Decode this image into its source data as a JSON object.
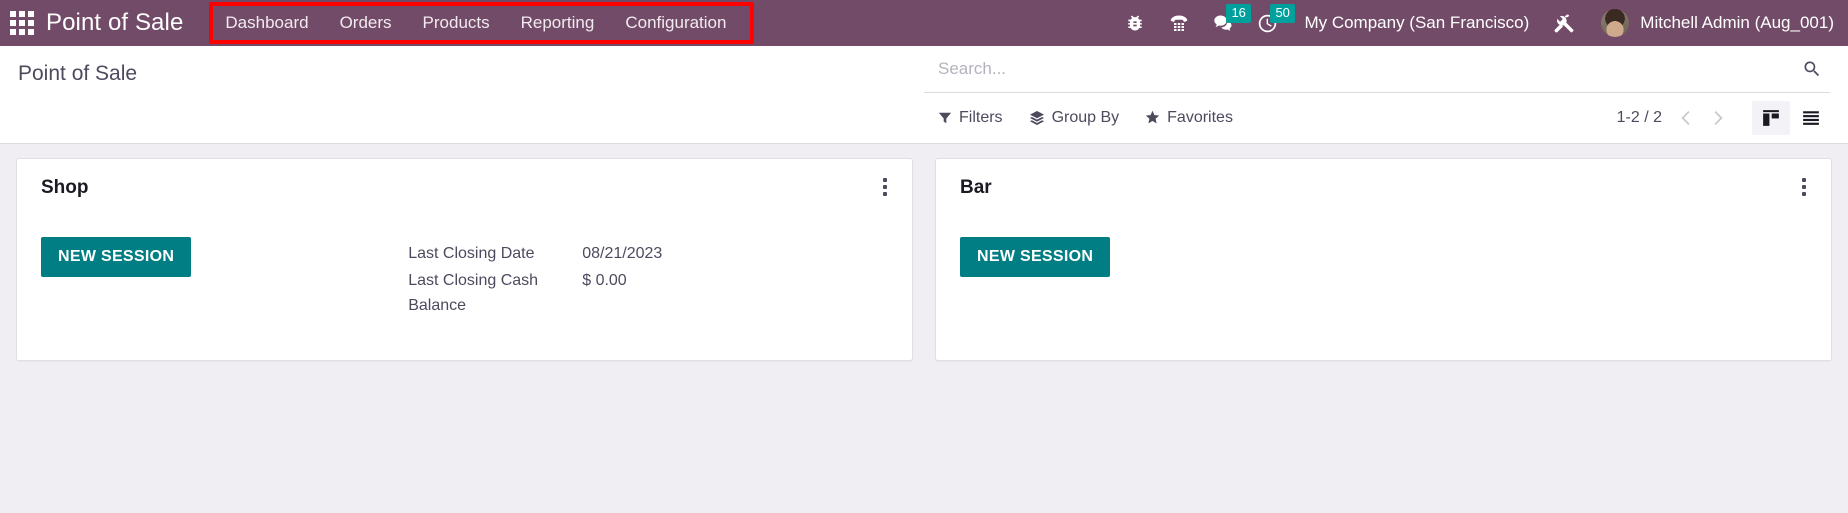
{
  "navbar": {
    "apps_icon": "apps-grid-icon",
    "brand": "Point of Sale",
    "menu_items": [
      {
        "label": "Dashboard"
      },
      {
        "label": "Orders"
      },
      {
        "label": "Products"
      },
      {
        "label": "Reporting"
      },
      {
        "label": "Configuration"
      }
    ],
    "system_icons": [
      {
        "name": "bug-icon",
        "badge": null
      },
      {
        "name": "phone-dialpad-icon",
        "badge": null
      },
      {
        "name": "chat-bubble-icon",
        "badge": "16"
      },
      {
        "name": "clock-activity-icon",
        "badge": "50"
      }
    ],
    "company": "My Company (San Francisco)",
    "tools_icon": "tools-icon",
    "user": "Mitchell Admin (Aug_001)",
    "badge_color": "#00a09d",
    "background_color": "#714b67"
  },
  "annotation": {
    "color": "#fe0000",
    "target": "main-menu-items"
  },
  "control_panel": {
    "breadcrumb": "Point of Sale",
    "search": {
      "placeholder": "Search...",
      "value": "",
      "icon": "search-icon"
    },
    "filter_buttons": [
      {
        "label": "Filters",
        "icon": "funnel-icon"
      },
      {
        "label": "Group By",
        "icon": "layers-icon"
      },
      {
        "label": "Favorites",
        "icon": "star-icon"
      }
    ],
    "pager": {
      "count": "1-2 / 2",
      "prev_icon": "chevron-left-icon",
      "next_icon": "chevron-right-icon"
    },
    "views": [
      {
        "name": "kanban-view",
        "icon": "kanban-icon",
        "active": true
      },
      {
        "name": "list-view",
        "icon": "list-icon",
        "active": false
      }
    ]
  },
  "kanban": {
    "cards": [
      {
        "title": "Shop",
        "button_label": "NEW SESSION",
        "button_color": "#017e84",
        "menu_icon": "kebab-menu-icon",
        "stats": [
          {
            "label": "Last Closing Date",
            "value": "08/21/2023"
          },
          {
            "label": "Last Closing Cash Balance",
            "value": "$ 0.00"
          }
        ]
      },
      {
        "title": "Bar",
        "button_label": "NEW SESSION",
        "button_color": "#017e84",
        "menu_icon": "kebab-menu-icon",
        "stats": []
      }
    ]
  }
}
